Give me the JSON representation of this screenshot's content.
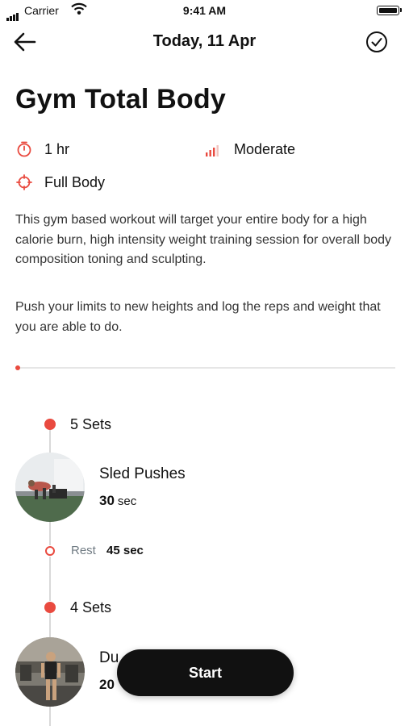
{
  "status_bar": {
    "carrier": "Carrier",
    "time": "9:41 AM"
  },
  "nav": {
    "title": "Today, 11 Apr",
    "back_icon": "arrow-left-icon",
    "complete_icon": "check-circle-icon"
  },
  "workout": {
    "title": "Gym Total Body",
    "duration": "1 hr",
    "intensity": "Moderate",
    "focus": "Full Body",
    "description_1": "This gym based workout will target your entire body for a high calorie burn, high intensity weight training session for overall body composition toning and sculpting.",
    "description_2": "Push your limits to new heights and log the reps and weight that you are able to do.",
    "progress": 0
  },
  "blocks": [
    {
      "sets": "5 Sets",
      "exercise": "Sled Pushes",
      "value": "30",
      "unit": "sec",
      "rest_label": "Rest",
      "rest_value": "45 sec"
    },
    {
      "sets": "4 Sets",
      "exercise": "Du",
      "value": "20",
      "unit": ""
    }
  ],
  "start_label": "Start",
  "colors": {
    "accent": "#e94a3f",
    "button": "#111111"
  }
}
